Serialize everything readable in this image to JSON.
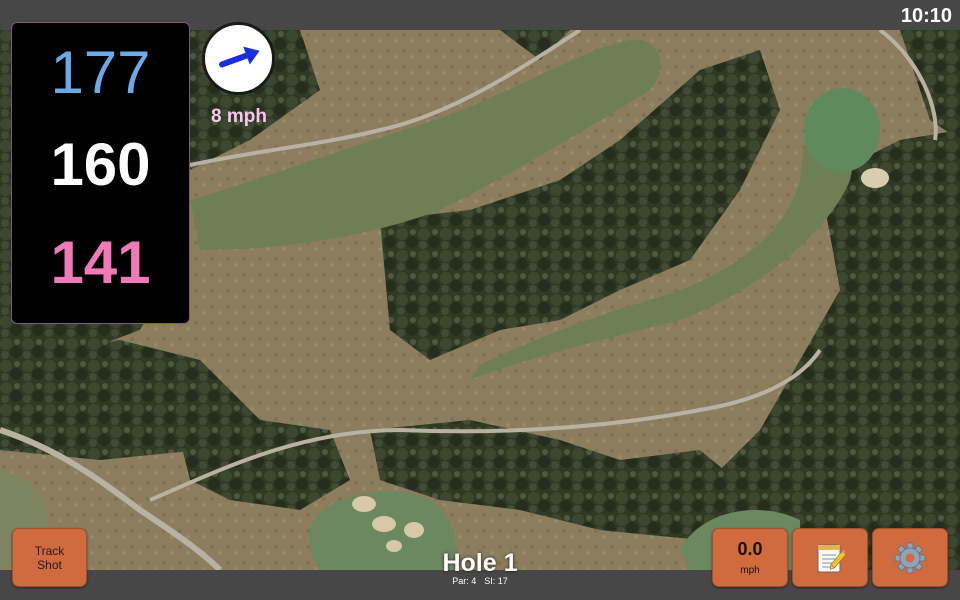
{
  "status_bar": {
    "time": "10:10"
  },
  "yardages": {
    "back": "177",
    "center": "160",
    "front": "141",
    "colors": {
      "back": "#6aa9ea",
      "center": "#ffffff",
      "front": "#f07ab8"
    }
  },
  "wind": {
    "speed_label": "8 mph",
    "direction_icon": "arrow-right-icon",
    "speed_color": "#f7c6ee",
    "arrow_color": "#1a2ee0"
  },
  "hole": {
    "title": "Hole 1",
    "par": "Par: 4",
    "stroke_index": "SI: 17"
  },
  "controls": {
    "track_shot_line1": "Track",
    "track_shot_line2": "Shot",
    "speed_value": "0.0",
    "speed_unit": "mph",
    "notes_icon": "notepad-icon",
    "settings_icon": "gear-icon",
    "button_color": "#cf6b3e"
  },
  "map": {
    "view": "aerial satellite view of golf hole"
  }
}
